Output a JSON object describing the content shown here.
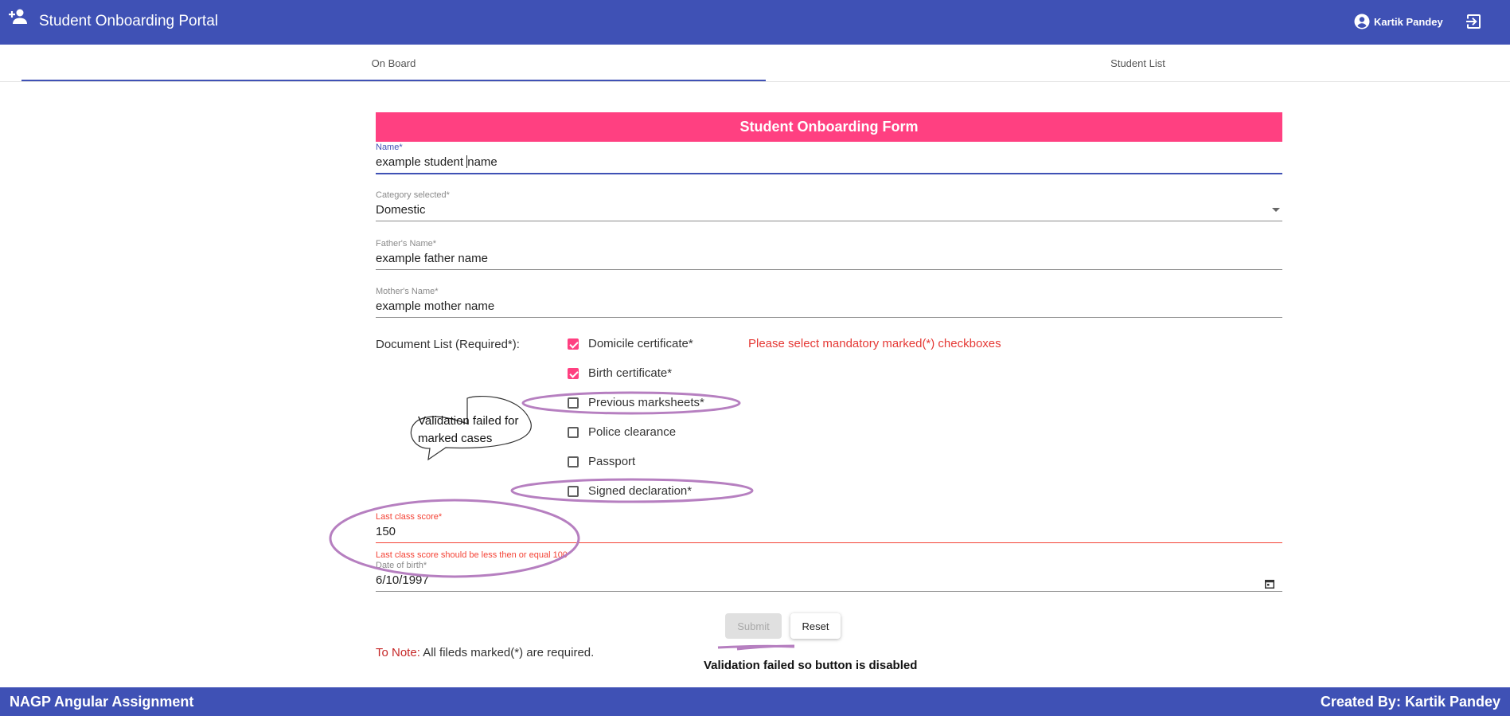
{
  "header": {
    "app_title": "Student Onboarding Portal",
    "user_name": "Kartik Pandey",
    "color": "#3f51b5"
  },
  "tabs": [
    {
      "label": "On Board",
      "active": true
    },
    {
      "label": "Student List",
      "active": false
    }
  ],
  "form": {
    "title": "Student Onboarding Form",
    "title_color": "#ff4081",
    "name": {
      "label": "Name*",
      "value_before_caret": "example student ",
      "value_after_caret": "name"
    },
    "category": {
      "label": "Category selected*",
      "value": "Domestic"
    },
    "father": {
      "label": "Father's Name*",
      "value": "example father name"
    },
    "mother": {
      "label": "Mother's Name*",
      "value": "example mother name"
    },
    "documents": {
      "label": "Document List (Required*):",
      "error": "Please select mandatory marked(*) checkboxes",
      "items": [
        {
          "label": "Domicile certificate*",
          "checked": true
        },
        {
          "label": "Birth certificate*",
          "checked": true
        },
        {
          "label": "Previous marksheets*",
          "checked": false
        },
        {
          "label": "Police clearance",
          "checked": false
        },
        {
          "label": "Passport",
          "checked": false
        },
        {
          "label": "Signed declaration*",
          "checked": false
        }
      ]
    },
    "score": {
      "label": "Last class score*",
      "value": "150",
      "error": "Last class score should be less then or equal 100"
    },
    "dob": {
      "label": "Date of birth*",
      "value": "6/10/1997"
    },
    "submit_label": "Submit",
    "reset_label": "Reset",
    "note_key": "To Note:",
    "note_text": " All fileds marked(*) are required."
  },
  "annotations": {
    "bubble_text": "Validation failed for marked cases",
    "button_note": "Validation failed so button is disabled",
    "color": "#b67fc0"
  },
  "footer": {
    "left": "NAGP Angular Assignment",
    "right": "Created By: Kartik Pandey"
  }
}
